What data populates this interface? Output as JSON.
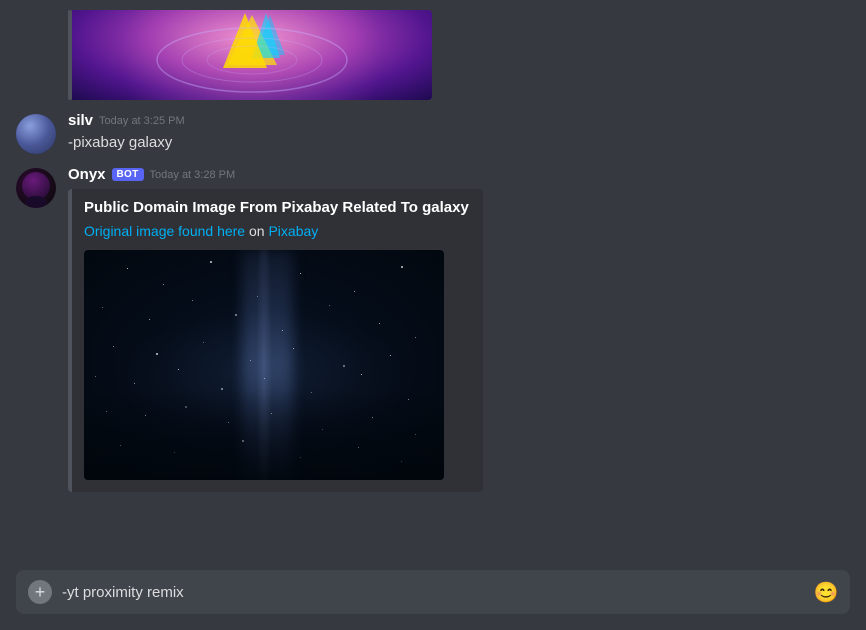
{
  "messages": [
    {
      "id": "msg1",
      "type": "image-only",
      "username": "silv",
      "avatarType": "silv",
      "timestamp": "Today at 3:25 PM",
      "text": "-pixabay galaxy",
      "hasTopImage": true
    },
    {
      "id": "msg2",
      "type": "embed",
      "username": "Onyx",
      "avatarType": "onyx",
      "isBot": true,
      "botLabel": "BOT",
      "timestamp": "Today at 3:28 PM",
      "embed": {
        "title": "Public Domain Image From Pixabay Related To galaxy",
        "linkText": "Original image found here",
        "midText": " on ",
        "linkText2": "Pixabay",
        "linkUrl": "#",
        "linkUrl2": "#"
      }
    }
  ],
  "input": {
    "placeholder": "",
    "value": "-yt proximity remix",
    "addButtonLabel": "+",
    "emojiLabel": "😊"
  },
  "colors": {
    "embedBar": "#4f545c",
    "background": "#36393f",
    "inputBg": "#40444b"
  }
}
